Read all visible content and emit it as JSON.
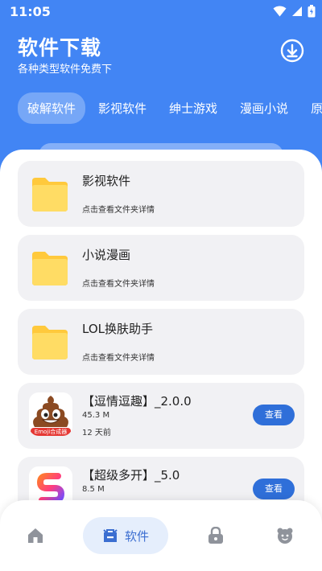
{
  "status": {
    "time": "11:05"
  },
  "header": {
    "title": "软件下载",
    "subtitle": "各种类型软件免费下"
  },
  "tabs": [
    {
      "label": "破解软件"
    },
    {
      "label": "影视软件"
    },
    {
      "label": "绅士游戏"
    },
    {
      "label": "漫画小说"
    },
    {
      "label": "原"
    }
  ],
  "folders": [
    {
      "title": "影视软件",
      "hint": "点击查看文件夹详情"
    },
    {
      "title": "小说漫画",
      "hint": "点击查看文件夹详情"
    },
    {
      "title": "LOL换肤助手",
      "hint": "点击查看文件夹详情"
    }
  ],
  "apps": [
    {
      "title": "【逗情逗趣】_2.0.0",
      "size": "45.3 M",
      "date": "12 天前",
      "button": "查看",
      "icon": "poop-emoji-icon",
      "icon_text": "Emoji合成器"
    },
    {
      "title": "【超级多开】_5.0",
      "size": "8.5 M",
      "button": "查看",
      "icon": "multi-open-s-icon"
    }
  ],
  "bottom_nav": {
    "active_label": "软件"
  },
  "colors": {
    "primary": "#4285f4",
    "button": "#2f6fd9",
    "folder": "#ffd54f",
    "nav_active_bg": "#e5eefc"
  }
}
